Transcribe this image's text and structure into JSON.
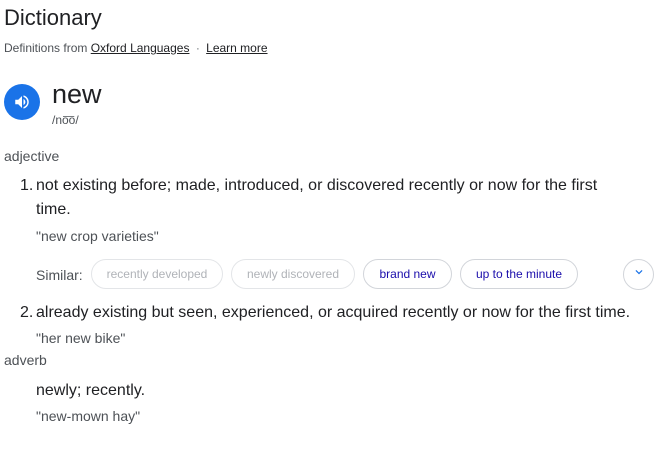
{
  "header": {
    "title": "Dictionary",
    "source_prefix": "Definitions from",
    "source_link": "Oxford Languages",
    "separator": "·",
    "learn_more": "Learn more"
  },
  "entry": {
    "word": "new",
    "phonetic": "/no͞o/",
    "speaker_icon": "speaker-icon"
  },
  "adjective": {
    "pos": "adjective",
    "senses": [
      {
        "number": "1.",
        "definition": "not existing before; made, introduced, or discovered recently or now for the first time.",
        "example": "\"new crop varieties\"",
        "similar_label": "Similar:",
        "similar": [
          "recently developed",
          "newly discovered",
          "brand new",
          "up to the minute"
        ],
        "expand_icon": "chevron-down-icon"
      },
      {
        "number": "2.",
        "definition": "already existing but seen, experienced, or acquired recently or now for the first time.",
        "example": "\"her new bike\""
      }
    ]
  },
  "adverb": {
    "pos": "adverb",
    "definition": "newly; recently.",
    "example": "\"new-mown hay\""
  },
  "colors": {
    "accent": "#1a73e8",
    "link": "#1a0dab",
    "secondary_text": "#4d5156"
  }
}
